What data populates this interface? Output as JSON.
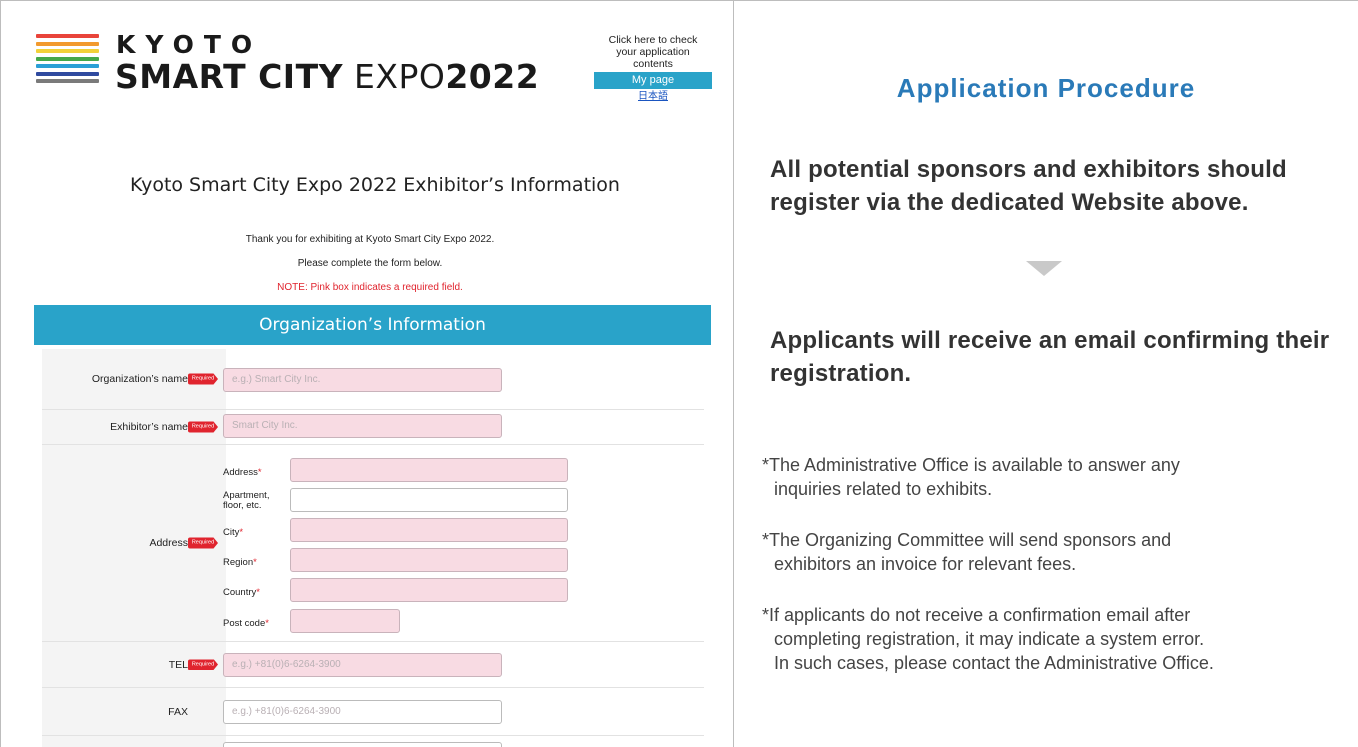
{
  "logo": {
    "kyoto": "KYOTO",
    "smart_city": "SMART CITY",
    "expo": "EXPO",
    "year": "2022",
    "stripe_colors": [
      "#e9443a",
      "#f29a2e",
      "#f2d13a",
      "#45a84a",
      "#2a9fd6",
      "#2f4a9f",
      "#7a7a7a"
    ]
  },
  "mypage": {
    "line1": "Click here to check",
    "line2": "your application",
    "line3": "contents",
    "button": "My page",
    "lang": "日本語"
  },
  "form": {
    "title": "Kyoto Smart City Expo 2022 Exhibitor’s Information",
    "intro1": "Thank you for exhibiting at Kyoto Smart City Expo 2022.",
    "intro2": "Please complete the form below.",
    "note": "NOTE: Pink box indicates a required field.",
    "section": "Organization’s Information",
    "required_badge": "Required",
    "rows": {
      "org_name": {
        "label": "Organization’s name",
        "placeholder": "e.g.) Smart City Inc."
      },
      "exhibitor_name": {
        "label": "Exhibitor’s name",
        "placeholder": "Smart City Inc."
      },
      "address": {
        "label": "Address",
        "address": "Address",
        "apartment1": "Apartment,",
        "apartment2": "floor, etc.",
        "city": "City",
        "region": "Region",
        "country": "Country",
        "postcode": "Post code",
        "asterisk": "*"
      },
      "tel": {
        "label": "TEL",
        "placeholder": "e.g.) +81(0)6-6264-3900"
      },
      "fax": {
        "label": "FAX",
        "placeholder": "e.g.) +81(0)6-6264-3900"
      }
    }
  },
  "procedure": {
    "title": "Application Procedure",
    "step1": "All potential sponsors and exhibitors should register via the dedicated Website above.",
    "step2": "Applicants will receive an email confirming their registration.",
    "note1_a": "*The Administrative Office is available to answer any",
    "note1_b": "inquiries related to exhibits.",
    "note2_a": "*The Organizing Committee will send sponsors and",
    "note2_b": "exhibitors an invoice for relevant fees.",
    "note3_a": "*If applicants do not receive a confirmation email after",
    "note3_b": "completing registration, it may indicate a system error.",
    "note3_c": "In such cases, please contact the Administrative Office."
  },
  "colors": {
    "accent_blue": "#29a3c9",
    "title_blue": "#2a7ab8",
    "required_red": "#e0242e",
    "required_field_pink": "#f8dbe3"
  }
}
